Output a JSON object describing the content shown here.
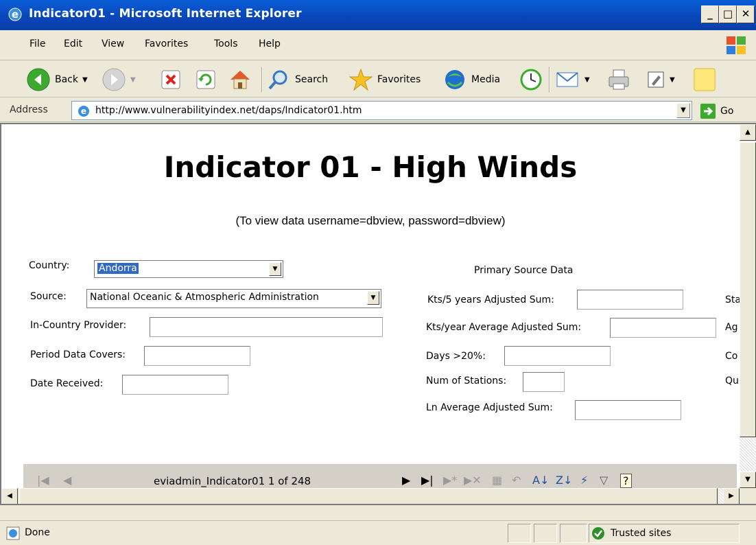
{
  "window": {
    "title": "Indicator01 - Microsoft Internet Explorer"
  },
  "window_buttons": {
    "minimize": "_",
    "maximize": "□",
    "close": "✕"
  },
  "menu": [
    "File",
    "Edit",
    "View",
    "Favorites",
    "Tools",
    "Help"
  ],
  "toolbar": {
    "back": "Back",
    "search": "Search",
    "favorites": "Favorites",
    "media": "Media"
  },
  "address": {
    "label": "Address",
    "url": "http://www.vulnerabilityindex.net/daps/Indicator01.htm",
    "go": "Go"
  },
  "page": {
    "title": "Indicator 01 - High Winds",
    "subtitle": "(To view data username=dbview, password=dbview)",
    "form": {
      "country_label": "Country:",
      "country_value": "Andorra",
      "source_label": "Source:",
      "source_value": "National Oceanic & Atmospheric Administration",
      "provider_label": "In-Country Provider:",
      "period_label": "Period Data Covers:",
      "date_label": "Date Received:"
    },
    "primary": {
      "heading": "Primary Source Data",
      "kts5_label": "Kts/5 years Adjusted Sum:",
      "ktsyear_label": "Kts/year Average Adjusted Sum:",
      "days_label": "Days >20%:",
      "stations_label": "Num of Stations:",
      "ln_label": "Ln Average Adjusted Sum:"
    },
    "clipped_labels": [
      "Sta",
      "Ag",
      "Co",
      "Qu"
    ],
    "navigator": {
      "record_text": "eviadmin_Indicator01 1 of 248"
    }
  },
  "status": {
    "text": "Done",
    "zone": "Trusted sites"
  }
}
